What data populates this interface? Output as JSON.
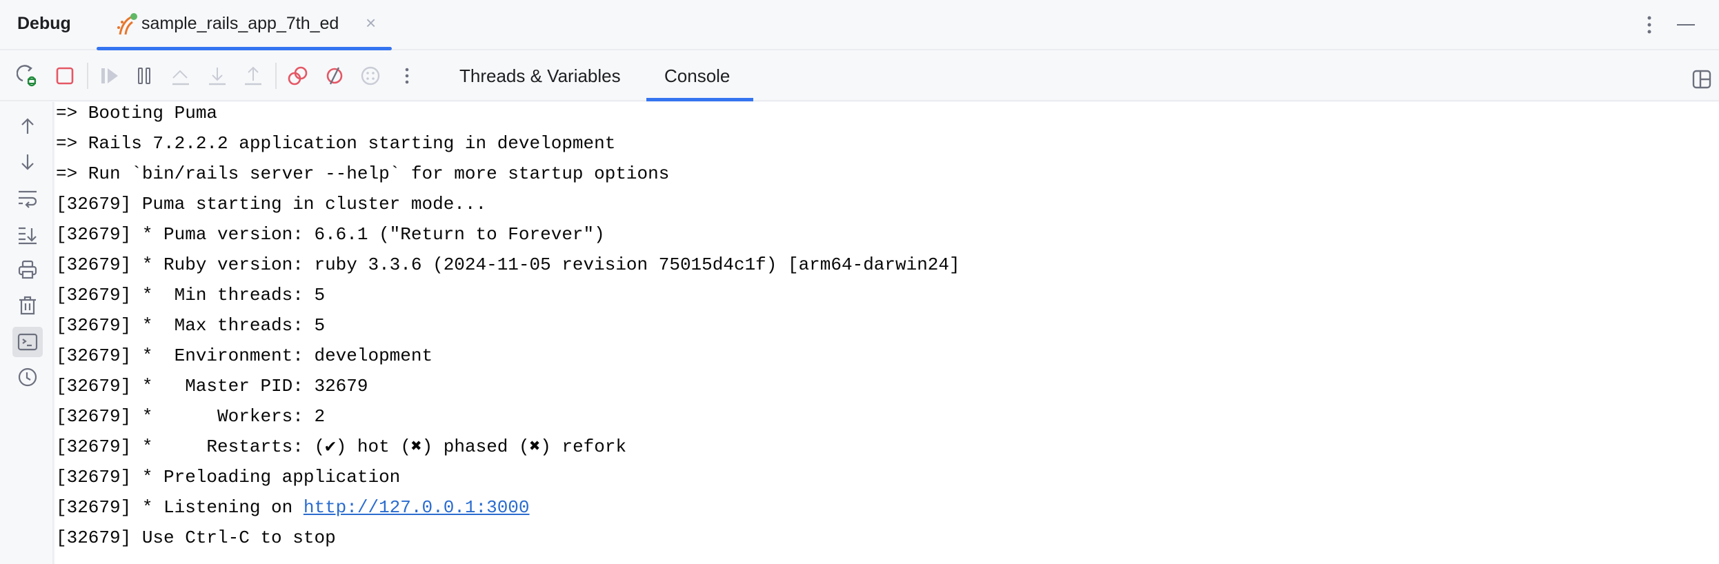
{
  "header": {
    "title": "Debug",
    "tab": {
      "label": "sample_rails_app_7th_ed",
      "close": "×"
    }
  },
  "toolbar": {
    "tabs": [
      {
        "label": "Threads & Variables"
      },
      {
        "label": "Console",
        "active": true
      }
    ]
  },
  "console": {
    "lines": [
      "=> Booting Puma",
      "=> Rails 7.2.2.2 application starting in development",
      "=> Run `bin/rails server --help` for more startup options",
      "[32679] Puma starting in cluster mode...",
      "[32679] * Puma version: 6.6.1 (\"Return to Forever\")",
      "[32679] * Ruby version: ruby 3.3.6 (2024-11-05 revision 75015d4c1f) [arm64-darwin24]",
      "[32679] *  Min threads: 5",
      "[32679] *  Max threads: 5",
      "[32679] *  Environment: development",
      "[32679] *   Master PID: 32679",
      "[32679] *      Workers: 2",
      "[32679] *     Restarts: (✔) hot (✖) phased (✖) refork",
      "[32679] * Preloading application",
      "[32679] * Listening on ",
      "[32679] Use Ctrl-C to stop"
    ],
    "link": "http://127.0.0.1:3000"
  },
  "colors": {
    "accent": "#3574f0",
    "stop": "#e55765",
    "rerun": "#208a3c",
    "link": "#2a6ccf"
  }
}
